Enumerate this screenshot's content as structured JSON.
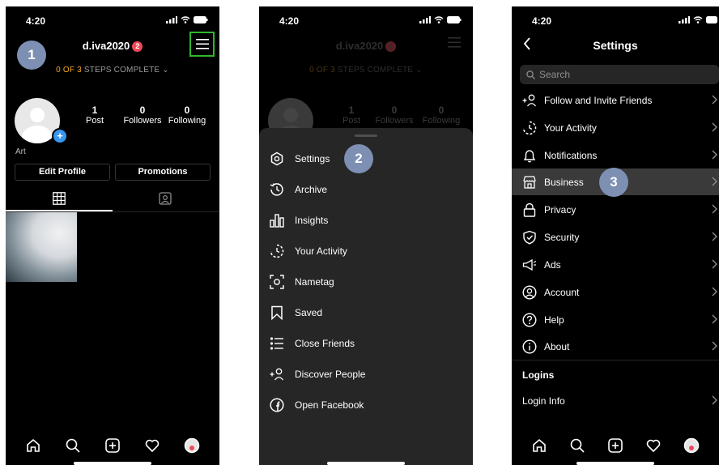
{
  "status": {
    "time": "4:20"
  },
  "profile": {
    "username": "d.iva2020",
    "notification_count": "2",
    "steps_prefix": "0 OF 3",
    "steps_suffix": "STEPS COMPLETE",
    "stats": [
      {
        "value": "1",
        "label": "Post"
      },
      {
        "value": "0",
        "label": "Followers"
      },
      {
        "value": "0",
        "label": "Following"
      }
    ],
    "bio": "Art",
    "edit_profile_label": "Edit Profile",
    "promotions_label": "Promotions"
  },
  "menu_sheet": {
    "items": [
      {
        "label": "Settings",
        "icon": "gear-icon"
      },
      {
        "label": "Archive",
        "icon": "archive-icon"
      },
      {
        "label": "Insights",
        "icon": "insights-icon"
      },
      {
        "label": "Your Activity",
        "icon": "activity-icon"
      },
      {
        "label": "Nametag",
        "icon": "nametag-icon"
      },
      {
        "label": "Saved",
        "icon": "bookmark-icon"
      },
      {
        "label": "Close Friends",
        "icon": "close-friends-icon"
      },
      {
        "label": "Discover People",
        "icon": "add-person-icon"
      },
      {
        "label": "Open Facebook",
        "icon": "facebook-icon"
      }
    ]
  },
  "settings": {
    "title": "Settings",
    "search_placeholder": "Search",
    "items": [
      {
        "label": "Follow and Invite Friends",
        "icon": "add-person-icon"
      },
      {
        "label": "Your Activity",
        "icon": "activity-icon"
      },
      {
        "label": "Notifications",
        "icon": "bell-icon"
      },
      {
        "label": "Business",
        "icon": "shop-icon"
      },
      {
        "label": "Privacy",
        "icon": "lock-icon"
      },
      {
        "label": "Security",
        "icon": "shield-icon"
      },
      {
        "label": "Ads",
        "icon": "megaphone-icon"
      },
      {
        "label": "Account",
        "icon": "account-icon"
      },
      {
        "label": "Help",
        "icon": "help-icon"
      },
      {
        "label": "About",
        "icon": "info-icon"
      }
    ],
    "logins_header": "Logins",
    "login_info_label": "Login Info"
  },
  "steps": {
    "one": "1",
    "two": "2",
    "three": "3"
  },
  "colors": {
    "accent_green": "#2eb82e",
    "badge": "#7d8fb3",
    "notif_red": "#ed4956",
    "steps_orange": "#f5a623",
    "link_blue": "#3897f0"
  }
}
